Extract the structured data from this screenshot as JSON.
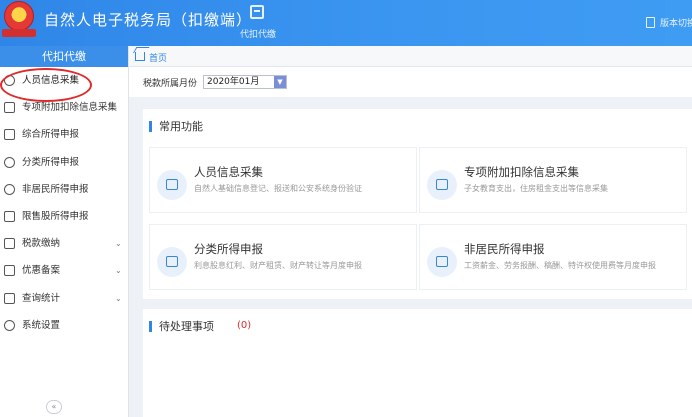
{
  "header": {
    "app_title": "自然人电子税务局（扣缴端）",
    "nav_tab_label": "代扣代缴",
    "version_label": "版本切换"
  },
  "sidebar": {
    "head": "代扣代缴",
    "items": [
      {
        "label": "人员信息采集",
        "icon": "person-icon",
        "caret": false
      },
      {
        "label": "专项附加扣除信息采集",
        "icon": "list-icon",
        "caret": false
      },
      {
        "label": "综合所得申报",
        "icon": "layers-icon",
        "caret": false
      },
      {
        "label": "分类所得申报",
        "icon": "pie-icon",
        "caret": false
      },
      {
        "label": "非居民所得申报",
        "icon": "user-icon",
        "caret": false
      },
      {
        "label": "限售股所得申报",
        "icon": "chart-icon",
        "caret": false
      },
      {
        "label": "税款缴纳",
        "icon": "folder-icon",
        "caret": true
      },
      {
        "label": "优惠备案",
        "icon": "document-icon",
        "caret": true
      },
      {
        "label": "查询统计",
        "icon": "search-list-icon",
        "caret": true
      },
      {
        "label": "系统设置",
        "icon": "gear-icon",
        "caret": false
      }
    ],
    "caret_glyph": "⌄",
    "collapse_glyph": "«"
  },
  "breadcrumb": {
    "home_label": "首页"
  },
  "period": {
    "label": "税款所属月份",
    "value": "2020年01月",
    "caret_glyph": "▼"
  },
  "common": {
    "title": "常用功能",
    "cards": [
      {
        "title": "人员信息采集",
        "desc": "自然人基础信息登记、报送和公安系统身份验证",
        "icon": "id-card-icon"
      },
      {
        "title": "专项附加扣除信息采集",
        "desc": "子女教育支出，住房租金支出等信息采集",
        "icon": "calendar-icon"
      },
      {
        "title": "分类所得申报",
        "desc": "利息股息红利、财产租赁、财产转让等月度申报",
        "icon": "edit-icon"
      },
      {
        "title": "非居民所得申报",
        "desc": "工资薪金、劳务报酬、稿酬、特许权使用费等月度申报",
        "icon": "edit-icon"
      }
    ]
  },
  "pending": {
    "title": "待处理事项",
    "count": "(0)"
  },
  "colors": {
    "primary": "#2f86e8",
    "highlight_ring": "#e02a2a"
  }
}
